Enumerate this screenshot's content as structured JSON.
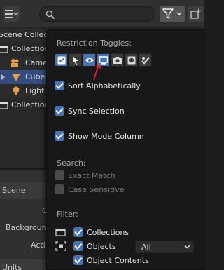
{
  "outliner": {
    "tree": [
      {
        "label": "Scene Collection",
        "icon": "scene-collection-icon"
      },
      {
        "label": "Collection",
        "icon": "collection-icon"
      },
      {
        "label": "Camera",
        "icon": "camera-icon"
      },
      {
        "label": "Cube",
        "icon": "mesh-icon"
      },
      {
        "label": "Light",
        "icon": "light-icon"
      },
      {
        "label": "Collection",
        "icon": "collection-icon"
      }
    ],
    "lower": {
      "section_scene": "Scene",
      "row_c": "C",
      "row_camera": "Camera",
      "row_background": "Backgroun",
      "row_active": "Acti",
      "section_units": "Units"
    }
  },
  "popover": {
    "restriction_header": "Restriction Toggles:",
    "toggles": [
      {
        "icon": "checkbox-icon",
        "on": true
      },
      {
        "icon": "cursor-icon",
        "on": false
      },
      {
        "icon": "eye-icon",
        "on": true
      },
      {
        "icon": "monitor-icon",
        "on": true
      },
      {
        "icon": "camera-icon",
        "on": false
      },
      {
        "icon": "holdout-icon",
        "on": false
      },
      {
        "icon": "indirect-only-icon",
        "on": false
      }
    ],
    "sort_alphabetically": "Sort Alphabetically",
    "sync_selection": "Sync Selection",
    "show_mode_column": "Show Mode Column",
    "search_header": "Search:",
    "exact_match": "Exact Match",
    "case_sensitive": "Case Sensitive",
    "filter_header": "Filter:",
    "collections": "Collections",
    "objects": "Objects",
    "objects_dropdown": "All",
    "object_contents": "Object Contents"
  },
  "colors": {
    "accent": "#4772b3",
    "selected_row": "#334d80",
    "annotation_arrow": "#e02020"
  }
}
